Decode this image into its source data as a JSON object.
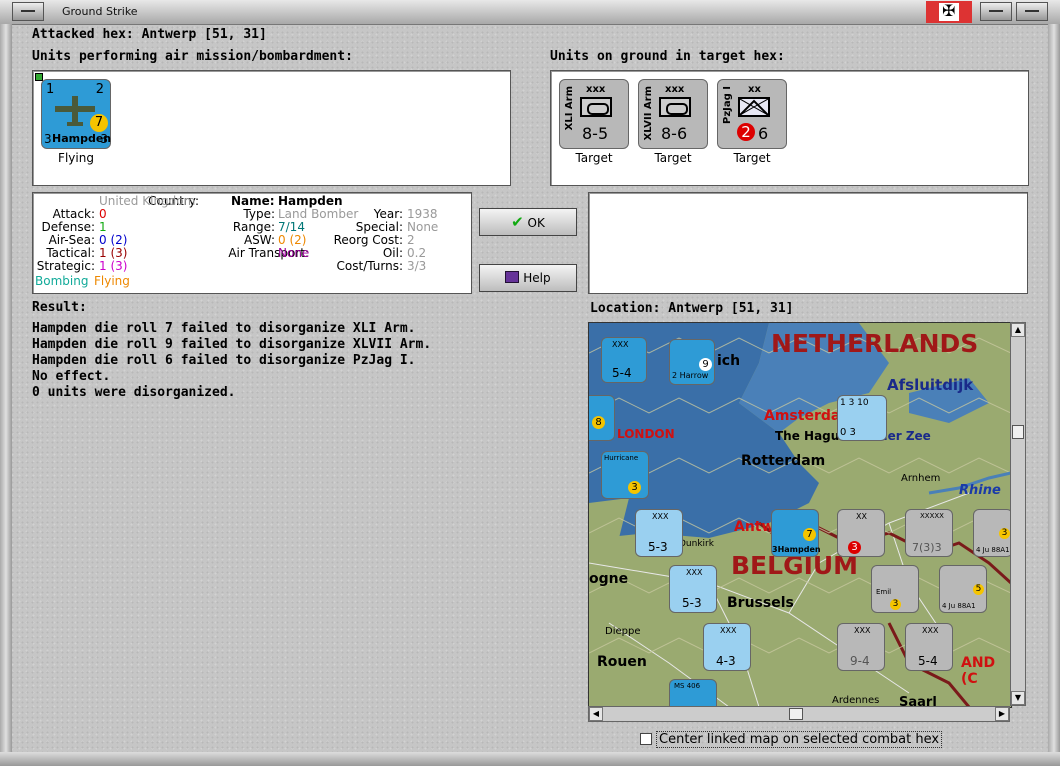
{
  "window": {
    "title": "Ground Strike"
  },
  "header": {
    "attacked_hex": "Attacked hex: Antwerp  [51, 31]"
  },
  "air_units": {
    "label": "Units performing air mission/bombardment:",
    "units": [
      {
        "top_left": "1",
        "top_right": "2",
        "name": "Hampden",
        "bottom_left": "3",
        "bottom_right": "3",
        "badge": "7",
        "status": "Flying"
      }
    ]
  },
  "ground_units": {
    "label": "Units on ground in target hex:",
    "units": [
      {
        "name": "XLI Arm",
        "size": "xxx",
        "values": "8-5",
        "status": "Target"
      },
      {
        "name": "XLVII Arm",
        "size": "xxx",
        "values": "8-6",
        "status": "Target"
      },
      {
        "name": "PzJag I",
        "size": "xx",
        "red": "2",
        "values": "6",
        "status": "Target"
      }
    ]
  },
  "info": {
    "country_label": "Country:",
    "country": "United Kingdom",
    "attack_label": "Attack:",
    "attack": "0",
    "defense_label": "Defense:",
    "defense": "1",
    "airsea_label": "Air-Sea:",
    "airsea": "0 (2)",
    "tactical_label": "Tactical:",
    "tactical": "1 (3)",
    "strategic_label": "Strategic:",
    "strategic": "1 (3)",
    "mission": "Bombing",
    "mission_status": "Flying",
    "name_label": "Name:",
    "name": "Hampden",
    "type_label": "Type:",
    "type": "Land Bomber",
    "year_label": "Year:",
    "year": "1938",
    "range_label": "Range:",
    "range": "7/14",
    "special_label": "Special:",
    "special": "None",
    "asw_label": "ASW:",
    "asw": "0 (2)",
    "reorg_label": "Reorg Cost:",
    "reorg": "2",
    "air_transport_label": "Air Transport:",
    "air_transport": "None",
    "oil_label": "Oil:",
    "oil": "0.2",
    "cost_label": "Cost/Turns:",
    "cost": "3/3"
  },
  "buttons": {
    "ok": "OK",
    "help": "Help"
  },
  "result": {
    "label": "Result:",
    "lines": [
      "Hampden die roll 7 failed to disorganize XLI Arm.",
      "Hampden die roll 9 failed to disorganize XLVII Arm.",
      "Hampden die roll 6 failed to disorganize PzJag I.",
      "No effect.",
      "0 units were disorganized."
    ]
  },
  "location": {
    "label": "Location:  Antwerp  [51, 31]"
  },
  "map": {
    "labels": [
      "NETHERLANDS",
      "Afsluitdijk",
      "Amsterdam",
      "The Hague",
      "der Zee",
      "Rotterdam",
      "LONDON",
      "Arnhem",
      "Rhine",
      "Antw",
      "BELGIUM",
      "Brussels",
      "Dieppe",
      "Rouen",
      "Ardennes",
      "Saarl",
      "Dunkirk",
      "ogne",
      "ich",
      "AND (C"
    ],
    "units": [
      {
        "line1": "XXX",
        "line2": "5-4"
      },
      {
        "line1": "2 Harrow",
        "line2": "9"
      },
      {
        "line1": "8",
        "line2": ""
      },
      {
        "line1": "Hurricane",
        "line2": "3"
      },
      {
        "line1": "XXX",
        "line2": "5-3"
      },
      {
        "line1": "XXX",
        "line2": "5-3"
      },
      {
        "line1": "3Hampden",
        "line2": "7"
      },
      {
        "line1": "XX",
        "line2": "3"
      },
      {
        "line1": "XXXXX",
        "line2": "7(3)3"
      },
      {
        "line1": "4 Ju 88A1",
        "line2": "3"
      },
      {
        "line1": "Emil",
        "line2": "3"
      },
      {
        "line1": "4 Ju 88A1",
        "line2": "5"
      },
      {
        "line1": "XXX",
        "line2": "4-3"
      },
      {
        "line1": "XXX",
        "line2": "9-4"
      },
      {
        "line1": "XXX",
        "line2": "5-4"
      },
      {
        "line1": "1  3  10",
        "line2": "0  3"
      },
      {
        "line1": "MS 406",
        "line2": ""
      }
    ]
  },
  "footer": {
    "checkbox_label": "Center linked map on selected combat hex"
  },
  "colors": {
    "air_counter": "#2e9bd6",
    "ground_counter": "#b8b8b8",
    "map_sea": "#3a6fa8",
    "map_land": "#9aaa70"
  }
}
